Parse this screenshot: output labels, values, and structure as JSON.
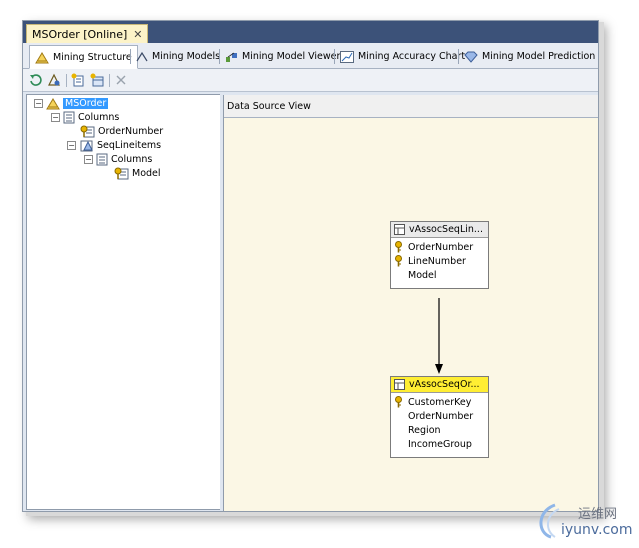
{
  "document_tab": {
    "title": "MSOrder [Online]",
    "close": "✕"
  },
  "designer_tabs": [
    {
      "label": "Mining Structure",
      "icon": "mining-structure-icon",
      "active": true
    },
    {
      "label": "Mining Models",
      "icon": "mining-models-icon",
      "active": false
    },
    {
      "label": "Mining Model Viewer",
      "icon": "model-viewer-icon",
      "active": false
    },
    {
      "label": "Mining Accuracy Chart",
      "icon": "accuracy-chart-icon",
      "active": false
    },
    {
      "label": "Mining Model Prediction",
      "icon": "model-prediction-icon",
      "active": false
    }
  ],
  "toolbar": {
    "buttons": [
      "refresh-icon",
      "process-icon",
      "add-column-icon",
      "add-nested-table-icon",
      "delete-icon"
    ]
  },
  "tree": {
    "root": "MSOrder",
    "columns_label": "Columns",
    "order_number": "OrderNumber",
    "nested_table": "SeqLineitems",
    "nested_columns_label": "Columns",
    "model": "Model"
  },
  "dsv": {
    "title": "Data Source View",
    "table1": {
      "name": "vAssocSeqLin...",
      "columns": [
        "OrderNumber",
        "LineNumber",
        "Model"
      ],
      "keys": [
        true,
        true,
        false
      ]
    },
    "table2": {
      "name": "vAssocSeqOr...",
      "columns": [
        "CustomerKey",
        "OrderNumber",
        "Region",
        "IncomeGroup"
      ],
      "keys": [
        true,
        false,
        false,
        false
      ]
    }
  },
  "watermark": {
    "cn": "运维网",
    "en": "iyunv.com"
  },
  "colors": {
    "selection": "#3399ff",
    "highlight_header": "#ffee33",
    "canvas": "#fbf7e5",
    "tab_strip": "#3c5279"
  }
}
